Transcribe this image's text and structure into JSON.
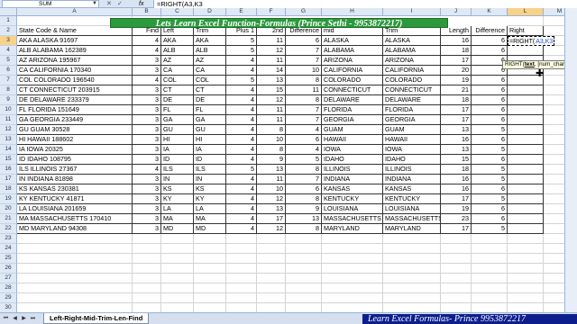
{
  "formula_bar": {
    "name_box": "SUM",
    "cancel_icon": "✕",
    "enter_icon": "✓",
    "fx_label": "fx",
    "formula": "=RIGHT(A3,K3"
  },
  "columns": [
    "A",
    "B",
    "C",
    "D",
    "E",
    "F",
    "G",
    "H",
    "I",
    "J",
    "K",
    "L",
    "M"
  ],
  "active_column": "L",
  "active_row": 3,
  "rows": [
    1,
    2,
    3,
    4,
    5,
    6,
    7,
    8,
    9,
    10,
    11,
    12,
    13,
    14,
    15,
    16,
    17,
    18,
    19,
    20,
    21,
    22,
    23,
    24,
    25,
    26,
    27,
    28,
    29,
    30
  ],
  "title": "Lets Learn Excel Function-Formulas (Prince Sethi - 9953872217)",
  "headers": [
    "State Code & Name",
    "Find",
    "Left",
    "Trim",
    "Plus 1",
    "2nd",
    "Difference",
    "mid",
    "Trim",
    "Length",
    "Difference",
    "Right"
  ],
  "data": [
    [
      "AKA ALASKA 91697",
      "4",
      "AKA",
      "AKA",
      "5",
      "11",
      "6",
      "ALASKA",
      "ALASKA",
      "16",
      "6"
    ],
    [
      "ALB ALABAMA 162389",
      "4",
      "ALB",
      "ALB",
      "5",
      "12",
      "7",
      "ALABAMA",
      "ALABAMA",
      "18",
      "6"
    ],
    [
      "AZ ARIZONA 195967",
      "3",
      "AZ",
      "AZ",
      "4",
      "11",
      "7",
      "ARIZONA",
      "ARIZONA",
      "17",
      "6"
    ],
    [
      "CA CALIFORNIA 170340",
      "3",
      "CA",
      "CA",
      "4",
      "14",
      "10",
      "CALIFORNIA",
      "CALIFORNIA",
      "20",
      "6"
    ],
    [
      "COL COLORADO 196540",
      "4",
      "COL",
      "COL",
      "5",
      "13",
      "8",
      "COLORADO",
      "COLORADO",
      "19",
      "6"
    ],
    [
      "CT CONNECTICUT 203915",
      "3",
      "CT",
      "CT",
      "4",
      "15",
      "11",
      "CONNECTICUT",
      "CONNECTICUT",
      "21",
      "6"
    ],
    [
      "DE DELAWARE 233379",
      "3",
      "DE",
      "DE",
      "4",
      "12",
      "8",
      "DELAWARE",
      "DELAWARE",
      "18",
      "6"
    ],
    [
      "FL FLORIDA 151649",
      "3",
      "FL",
      "FL",
      "4",
      "11",
      "7",
      "FLORIDA",
      "FLORIDA",
      "17",
      "6"
    ],
    [
      "GA GEORGIA 233449",
      "3",
      "GA",
      "GA",
      "4",
      "11",
      "7",
      "GEORGIA",
      "GEORGIA",
      "17",
      "6"
    ],
    [
      "GU GUAM 30528",
      "3",
      "GU",
      "GU",
      "4",
      "8",
      "4",
      "GUAM",
      "GUAM",
      "13",
      "5"
    ],
    [
      "HI HAWAII 188602",
      "3",
      "HI",
      "HI",
      "4",
      "10",
      "6",
      "HAWAII",
      "HAWAII",
      "16",
      "6"
    ],
    [
      "IA IOWA 20325",
      "3",
      "IA",
      "IA",
      "4",
      "8",
      "4",
      "IOWA",
      "IOWA",
      "13",
      "5"
    ],
    [
      "ID IDAHO 108795",
      "3",
      "ID",
      "ID",
      "4",
      "9",
      "5",
      "IDAHO",
      "IDAHO",
      "15",
      "6"
    ],
    [
      "ILS ILLINOIS 27367",
      "4",
      "ILS",
      "ILS",
      "5",
      "13",
      "8",
      "ILLINOIS",
      "ILLINOIS",
      "18",
      "5"
    ],
    [
      "IN INDIANA 81898",
      "3",
      "IN",
      "IN",
      "4",
      "11",
      "7",
      "INDIANA",
      "INDIANA",
      "16",
      "5"
    ],
    [
      "KS KANSAS 230381",
      "3",
      "KS",
      "KS",
      "4",
      "10",
      "6",
      "KANSAS",
      "KANSAS",
      "16",
      "6"
    ],
    [
      "KY KENTUCKY 41871",
      "3",
      "KY",
      "KY",
      "4",
      "12",
      "8",
      "KENTUCKY",
      "KENTUCKY",
      "17",
      "5"
    ],
    [
      "LA LOUISIANA 201659",
      "3",
      "LA",
      "LA",
      "4",
      "13",
      "9",
      "LOUISIANA",
      "LOUISIANA",
      "19",
      "6"
    ],
    [
      "MA MASSACHUSETTS 170410",
      "3",
      "MA",
      "MA",
      "4",
      "17",
      "13",
      "MASSACHUSETTS",
      "MASSACHUSETTS",
      "23",
      "6"
    ],
    [
      "MD MARYLAND 94308",
      "3",
      "MD",
      "MD",
      "4",
      "12",
      "8",
      "MARYLAND",
      "MARYLAND",
      "17",
      "5"
    ]
  ],
  "active_cell": {
    "prefix": "=RIGHT(",
    "ref1": "A3",
    "sep": ",",
    "ref2": "K3"
  },
  "tooltip": {
    "text": "RIGHT(text, [num_chars])",
    "func": "RIGHT(",
    "arg1": "text",
    "rest": ", [num_chars])"
  },
  "sheet_tab": "Left-Right-Mid-Trim-Len-Find",
  "footer_banner": "Learn Excel Formulas- Prince 9953872217",
  "colors": {
    "title_bg": "#2b9a3c",
    "footer_bg": "#0d1e8c",
    "active_header": "#f8d288"
  }
}
